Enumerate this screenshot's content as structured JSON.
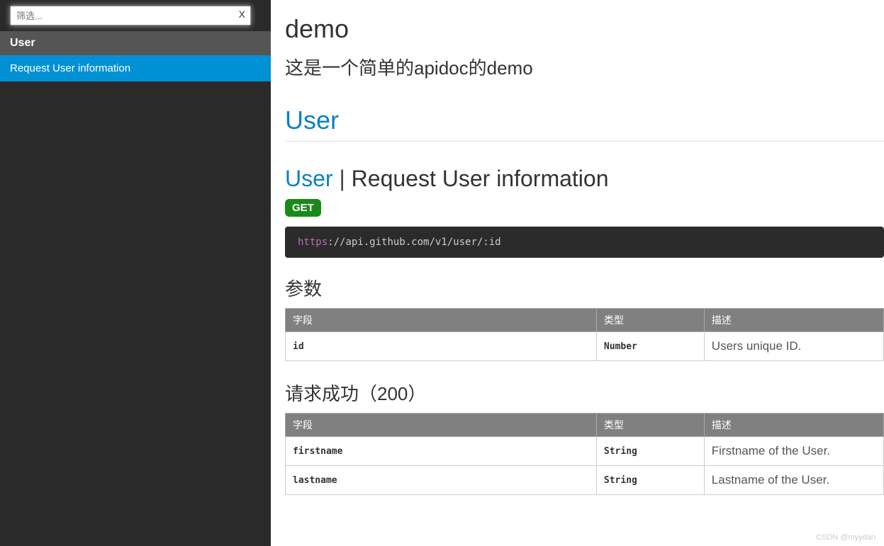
{
  "sidebar": {
    "search_placeholder": "筛选...",
    "clear_label": "X",
    "group_label": "User",
    "item_label": "Request User information"
  },
  "header": {
    "title": "demo",
    "description": "这是一个简单的apidoc的demo"
  },
  "section": {
    "title": "User"
  },
  "endpoint": {
    "group": "User",
    "separator": " | ",
    "name": "Request User information",
    "method": "GET",
    "url_scheme": "https",
    "url_rest": "://api.github.com/v1/user/:id"
  },
  "params": {
    "heading": "参数",
    "columns": {
      "field": "字段",
      "type": "类型",
      "desc": "描述"
    },
    "rows": [
      {
        "field": "id",
        "type": "Number",
        "desc": "Users unique ID."
      }
    ]
  },
  "success": {
    "heading": "请求成功（200）",
    "columns": {
      "field": "字段",
      "type": "类型",
      "desc": "描述"
    },
    "rows": [
      {
        "field": "firstname",
        "type": "String",
        "desc": "Firstname of the User."
      },
      {
        "field": "lastname",
        "type": "String",
        "desc": "Lastname of the User."
      }
    ]
  },
  "watermark": "CSDN @myydan"
}
